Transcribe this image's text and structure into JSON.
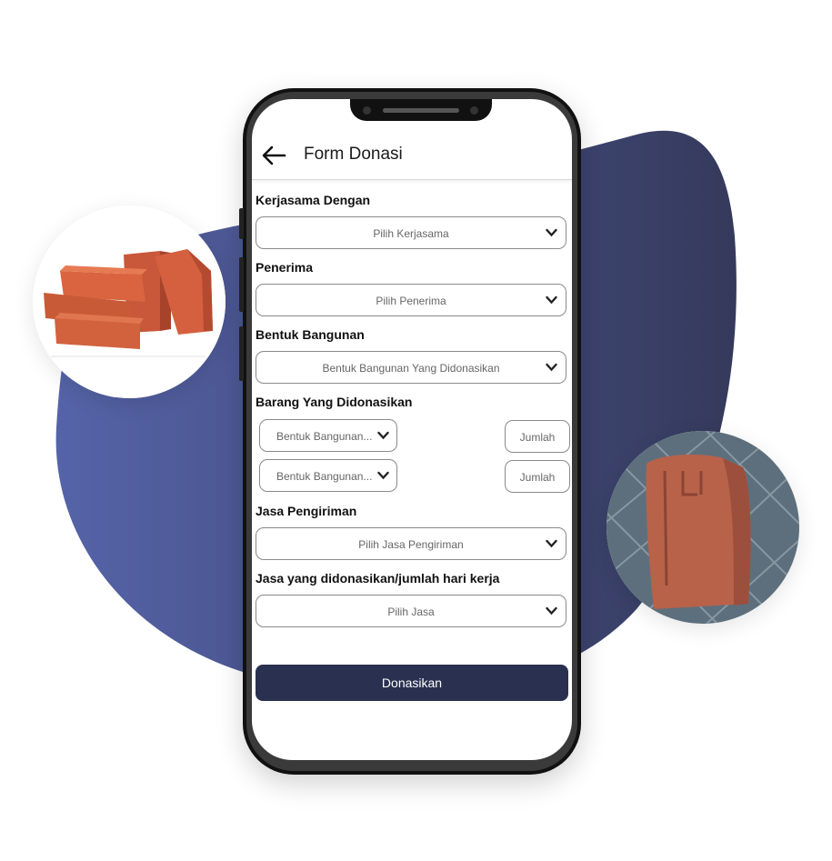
{
  "header": {
    "title": "Form Donasi",
    "back_icon": "arrow-left-icon"
  },
  "colors": {
    "blob": "#4a5596",
    "button": "#2a3150",
    "field_border": "#8a8a8a"
  },
  "form": {
    "kerjasama": {
      "label": "Kerjasama Dengan",
      "value": "Pilih Kerjasama"
    },
    "penerima": {
      "label": "Penerima",
      "value": "Pilih Penerima"
    },
    "bentuk": {
      "label": "Bentuk Bangunan",
      "value": "Bentuk Bangunan Yang Didonasikan"
    },
    "barang": {
      "label": "Barang Yang Didonasikan",
      "rows": [
        {
          "value": "Bentuk Bangunan...",
          "qty_placeholder": "Jumlah"
        },
        {
          "value": "Bentuk Bangunan...",
          "qty_placeholder": "Jumlah"
        }
      ]
    },
    "pengiriman": {
      "label": "Jasa Pengiriman",
      "value": "Pilih Jasa Pengiriman"
    },
    "jasa": {
      "label": "Jasa yang didonasikan/jumlah hari kerja",
      "value": "Pilih Jasa"
    },
    "submit_label": "Donasikan"
  },
  "decor": {
    "left_photo": "bricks-photo",
    "right_photo": "roof-tile-photo"
  }
}
